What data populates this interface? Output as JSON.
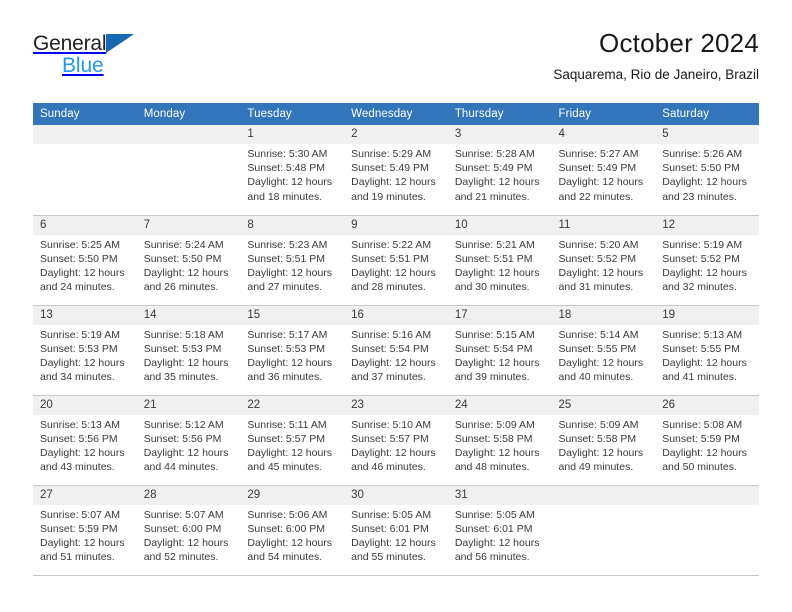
{
  "brand": {
    "name_top": "General",
    "name_bottom": "Blue",
    "triangle_color": "#1668b3",
    "blue_text_color": "#2196f3"
  },
  "header": {
    "title": "October 2024",
    "subtitle": "Saquarema, Rio de Janeiro, Brazil"
  },
  "theme": {
    "header_bg": "#3275ba",
    "header_text": "#ffffff",
    "daynum_bg": "#f0f0f0",
    "cell_border": "#c8c8c8"
  },
  "weekdays": [
    "Sunday",
    "Monday",
    "Tuesday",
    "Wednesday",
    "Thursday",
    "Friday",
    "Saturday"
  ],
  "labels": {
    "sunrise_prefix": "Sunrise:",
    "sunset_prefix": "Sunset:",
    "daylight_prefix": "Daylight:"
  },
  "weeks": [
    [
      {
        "day": "",
        "empty": true
      },
      {
        "day": "",
        "empty": true
      },
      {
        "day": "1",
        "sunrise": "Sunrise: 5:30 AM",
        "sunset": "Sunset: 5:48 PM",
        "daylight": "Daylight: 12 hours and 18 minutes."
      },
      {
        "day": "2",
        "sunrise": "Sunrise: 5:29 AM",
        "sunset": "Sunset: 5:49 PM",
        "daylight": "Daylight: 12 hours and 19 minutes."
      },
      {
        "day": "3",
        "sunrise": "Sunrise: 5:28 AM",
        "sunset": "Sunset: 5:49 PM",
        "daylight": "Daylight: 12 hours and 21 minutes."
      },
      {
        "day": "4",
        "sunrise": "Sunrise: 5:27 AM",
        "sunset": "Sunset: 5:49 PM",
        "daylight": "Daylight: 12 hours and 22 minutes."
      },
      {
        "day": "5",
        "sunrise": "Sunrise: 5:26 AM",
        "sunset": "Sunset: 5:50 PM",
        "daylight": "Daylight: 12 hours and 23 minutes."
      }
    ],
    [
      {
        "day": "6",
        "sunrise": "Sunrise: 5:25 AM",
        "sunset": "Sunset: 5:50 PM",
        "daylight": "Daylight: 12 hours and 24 minutes."
      },
      {
        "day": "7",
        "sunrise": "Sunrise: 5:24 AM",
        "sunset": "Sunset: 5:50 PM",
        "daylight": "Daylight: 12 hours and 26 minutes."
      },
      {
        "day": "8",
        "sunrise": "Sunrise: 5:23 AM",
        "sunset": "Sunset: 5:51 PM",
        "daylight": "Daylight: 12 hours and 27 minutes."
      },
      {
        "day": "9",
        "sunrise": "Sunrise: 5:22 AM",
        "sunset": "Sunset: 5:51 PM",
        "daylight": "Daylight: 12 hours and 28 minutes."
      },
      {
        "day": "10",
        "sunrise": "Sunrise: 5:21 AM",
        "sunset": "Sunset: 5:51 PM",
        "daylight": "Daylight: 12 hours and 30 minutes."
      },
      {
        "day": "11",
        "sunrise": "Sunrise: 5:20 AM",
        "sunset": "Sunset: 5:52 PM",
        "daylight": "Daylight: 12 hours and 31 minutes."
      },
      {
        "day": "12",
        "sunrise": "Sunrise: 5:19 AM",
        "sunset": "Sunset: 5:52 PM",
        "daylight": "Daylight: 12 hours and 32 minutes."
      }
    ],
    [
      {
        "day": "13",
        "sunrise": "Sunrise: 5:19 AM",
        "sunset": "Sunset: 5:53 PM",
        "daylight": "Daylight: 12 hours and 34 minutes."
      },
      {
        "day": "14",
        "sunrise": "Sunrise: 5:18 AM",
        "sunset": "Sunset: 5:53 PM",
        "daylight": "Daylight: 12 hours and 35 minutes."
      },
      {
        "day": "15",
        "sunrise": "Sunrise: 5:17 AM",
        "sunset": "Sunset: 5:53 PM",
        "daylight": "Daylight: 12 hours and 36 minutes."
      },
      {
        "day": "16",
        "sunrise": "Sunrise: 5:16 AM",
        "sunset": "Sunset: 5:54 PM",
        "daylight": "Daylight: 12 hours and 37 minutes."
      },
      {
        "day": "17",
        "sunrise": "Sunrise: 5:15 AM",
        "sunset": "Sunset: 5:54 PM",
        "daylight": "Daylight: 12 hours and 39 minutes."
      },
      {
        "day": "18",
        "sunrise": "Sunrise: 5:14 AM",
        "sunset": "Sunset: 5:55 PM",
        "daylight": "Daylight: 12 hours and 40 minutes."
      },
      {
        "day": "19",
        "sunrise": "Sunrise: 5:13 AM",
        "sunset": "Sunset: 5:55 PM",
        "daylight": "Daylight: 12 hours and 41 minutes."
      }
    ],
    [
      {
        "day": "20",
        "sunrise": "Sunrise: 5:13 AM",
        "sunset": "Sunset: 5:56 PM",
        "daylight": "Daylight: 12 hours and 43 minutes."
      },
      {
        "day": "21",
        "sunrise": "Sunrise: 5:12 AM",
        "sunset": "Sunset: 5:56 PM",
        "daylight": "Daylight: 12 hours and 44 minutes."
      },
      {
        "day": "22",
        "sunrise": "Sunrise: 5:11 AM",
        "sunset": "Sunset: 5:57 PM",
        "daylight": "Daylight: 12 hours and 45 minutes."
      },
      {
        "day": "23",
        "sunrise": "Sunrise: 5:10 AM",
        "sunset": "Sunset: 5:57 PM",
        "daylight": "Daylight: 12 hours and 46 minutes."
      },
      {
        "day": "24",
        "sunrise": "Sunrise: 5:09 AM",
        "sunset": "Sunset: 5:58 PM",
        "daylight": "Daylight: 12 hours and 48 minutes."
      },
      {
        "day": "25",
        "sunrise": "Sunrise: 5:09 AM",
        "sunset": "Sunset: 5:58 PM",
        "daylight": "Daylight: 12 hours and 49 minutes."
      },
      {
        "day": "26",
        "sunrise": "Sunrise: 5:08 AM",
        "sunset": "Sunset: 5:59 PM",
        "daylight": "Daylight: 12 hours and 50 minutes."
      }
    ],
    [
      {
        "day": "27",
        "sunrise": "Sunrise: 5:07 AM",
        "sunset": "Sunset: 5:59 PM",
        "daylight": "Daylight: 12 hours and 51 minutes."
      },
      {
        "day": "28",
        "sunrise": "Sunrise: 5:07 AM",
        "sunset": "Sunset: 6:00 PM",
        "daylight": "Daylight: 12 hours and 52 minutes."
      },
      {
        "day": "29",
        "sunrise": "Sunrise: 5:06 AM",
        "sunset": "Sunset: 6:00 PM",
        "daylight": "Daylight: 12 hours and 54 minutes."
      },
      {
        "day": "30",
        "sunrise": "Sunrise: 5:05 AM",
        "sunset": "Sunset: 6:01 PM",
        "daylight": "Daylight: 12 hours and 55 minutes."
      },
      {
        "day": "31",
        "sunrise": "Sunrise: 5:05 AM",
        "sunset": "Sunset: 6:01 PM",
        "daylight": "Daylight: 12 hours and 56 minutes."
      },
      {
        "day": "",
        "empty": true
      },
      {
        "day": "",
        "empty": true
      }
    ]
  ]
}
